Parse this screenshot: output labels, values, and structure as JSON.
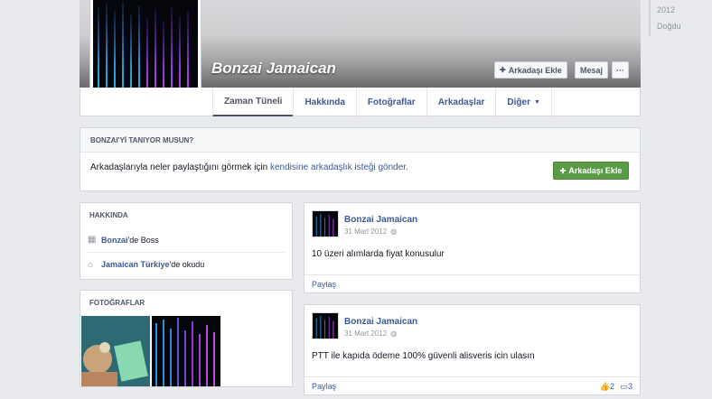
{
  "profile": {
    "name": "Bonzai Jamaican"
  },
  "header_buttons": {
    "add_friend": "Arkadaşı Ekle",
    "message": "Mesaj",
    "more": "···"
  },
  "tabs": [
    {
      "label": "Zaman Tüneli"
    },
    {
      "label": "Hakkında"
    },
    {
      "label": "Fotoğraflar"
    },
    {
      "label": "Arkadaşlar"
    },
    {
      "label": "Diğer"
    }
  ],
  "timeline_years": [
    "2012",
    "Doğdu"
  ],
  "know_box": {
    "title": "BONZAI'Yİ TANIYOR MUSUN?",
    "text_prefix": "Arkadaşlarıyla neler paylaştığını görmek için ",
    "text_link": "kendisine arkadaşlık isteği gönder.",
    "button": "Arkadaşı Ekle"
  },
  "about": {
    "title": "HAKKINDA",
    "items": [
      {
        "link": "Bonzai",
        "rest": "'de Boss"
      },
      {
        "link": "Jamaican Türkiye",
        "rest": "'de okudu"
      }
    ]
  },
  "photos": {
    "title": "FOTOĞRAFLAR"
  },
  "posts": [
    {
      "author": "Bonzai Jamaican",
      "date": "31 Mart 2012",
      "text": "10 üzeri alımlarda fiyat konusulur",
      "share": "Paylaş"
    },
    {
      "author": "Bonzai Jamaican",
      "date": "31 Mart 2012",
      "text": "PTT ile kapıda ödeme 100% güvenli alisveris icin ulasın",
      "share": "Paylaş",
      "likes": "2",
      "comments": "3"
    }
  ],
  "colors": {
    "link": "#3b5998",
    "green_button": "#5b9a46",
    "page_bg": "#e9eaed"
  }
}
